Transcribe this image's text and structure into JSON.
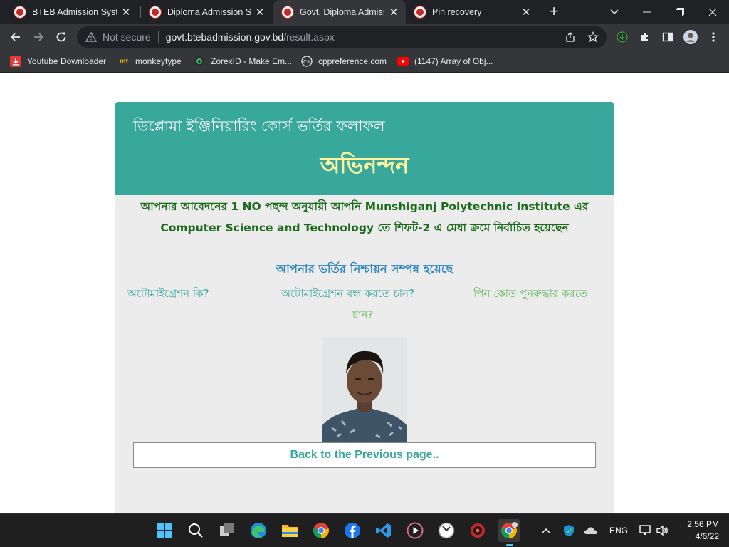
{
  "browser": {
    "tabs": [
      {
        "title": "BTEB Admission System",
        "active": false
      },
      {
        "title": "Diploma Admission System",
        "active": false
      },
      {
        "title": "Govt. Diploma Admission",
        "active": true
      },
      {
        "title": "Pin recovery",
        "active": false
      }
    ],
    "new_tab": "+",
    "window_controls": {
      "minimize": "—",
      "maximize": "❐",
      "close": "✕",
      "tab_search": "⌄"
    },
    "omnibox": {
      "security_label": "Not secure",
      "host": "govt.btebadmission.gov.bd",
      "path": "/result.aspx"
    },
    "bookmarks": [
      {
        "label": "Youtube Downloader",
        "icon": "youtube-downloader-icon"
      },
      {
        "label": "monkeytype",
        "icon": "monkeytype-icon",
        "icon_text": "mt"
      },
      {
        "label": "ZorexID - Make Em...",
        "icon": "zorexid-icon"
      },
      {
        "label": "cppreference.com",
        "icon": "cppreference-icon"
      },
      {
        "label": "(1147) Array of Obj...",
        "icon": "youtube-icon"
      }
    ]
  },
  "page": {
    "header_subtitle": "ডিপ্লোমা ইঞ্জিনিয়ারিং কোর্স ভর্তির ফলাফল",
    "header_title": "অভিনন্দন",
    "result_message": "আপনার আবেদনের 1 NO পছন্দ অনুযায়ী আপনি Munshiganj Polytechnic Institute এর Computer Science and Technology তে শিফট-2 এ মেধা ক্রমে নির্বাচিত হয়েছেন",
    "confirmation": "আপনার ভর্তির নিশ্চায়ন সম্পন্ন হয়েছে",
    "links": {
      "auto_migration_what": "অটোমাইগ্রেশন কি?",
      "stop_auto_migration": "অটোমাইগ্রেশন বন্ধ করতে চান?",
      "pin_recovery": "পিন কোড পুনরুদ্ধার করতে",
      "pin_recovery_cont": "চান?"
    },
    "back_button": "Back to the Previous page..",
    "colors": {
      "header": "#38a89d",
      "title": "#fff59d",
      "result": "#1b6b1b",
      "confirm": "#2d86c4",
      "link_green": "#5cb85c"
    }
  },
  "taskbar": {
    "apps": [
      "windows-start-icon",
      "search-icon",
      "task-view-icon",
      "edge-icon",
      "file-explorer-icon",
      "chrome-icon",
      "facebook-icon",
      "vscode-icon",
      "media-player-icon",
      "clock-app-icon",
      "game-app-icon",
      "chrome-profile-icon"
    ],
    "tray": {
      "language": "ENG",
      "chevron": "^"
    },
    "time": "2:56 PM",
    "date": "4/6/22"
  }
}
